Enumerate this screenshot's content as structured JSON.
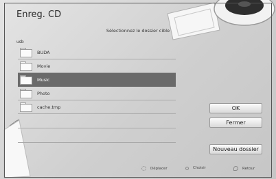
{
  "dialog": {
    "title": "Enreg. CD",
    "instruction": "Sélectionnez le dossier cible",
    "path": "usb"
  },
  "folders": [
    {
      "name": "BUDA",
      "selected": false
    },
    {
      "name": "Movie",
      "selected": false
    },
    {
      "name": "Music",
      "selected": true
    },
    {
      "name": "Photo",
      "selected": false
    },
    {
      "name": "cache.tmp",
      "selected": false
    }
  ],
  "buttons": {
    "ok": "OK",
    "close": "Fermer",
    "new_folder": "Nouveau dossier"
  },
  "footer": {
    "move": "Déplacer",
    "choose": "Choisir",
    "back": "Retour"
  },
  "icons": {
    "folder": "folder-icon",
    "move": "directional-pad-icon",
    "choose": "enter-icon",
    "back": "return-icon"
  }
}
